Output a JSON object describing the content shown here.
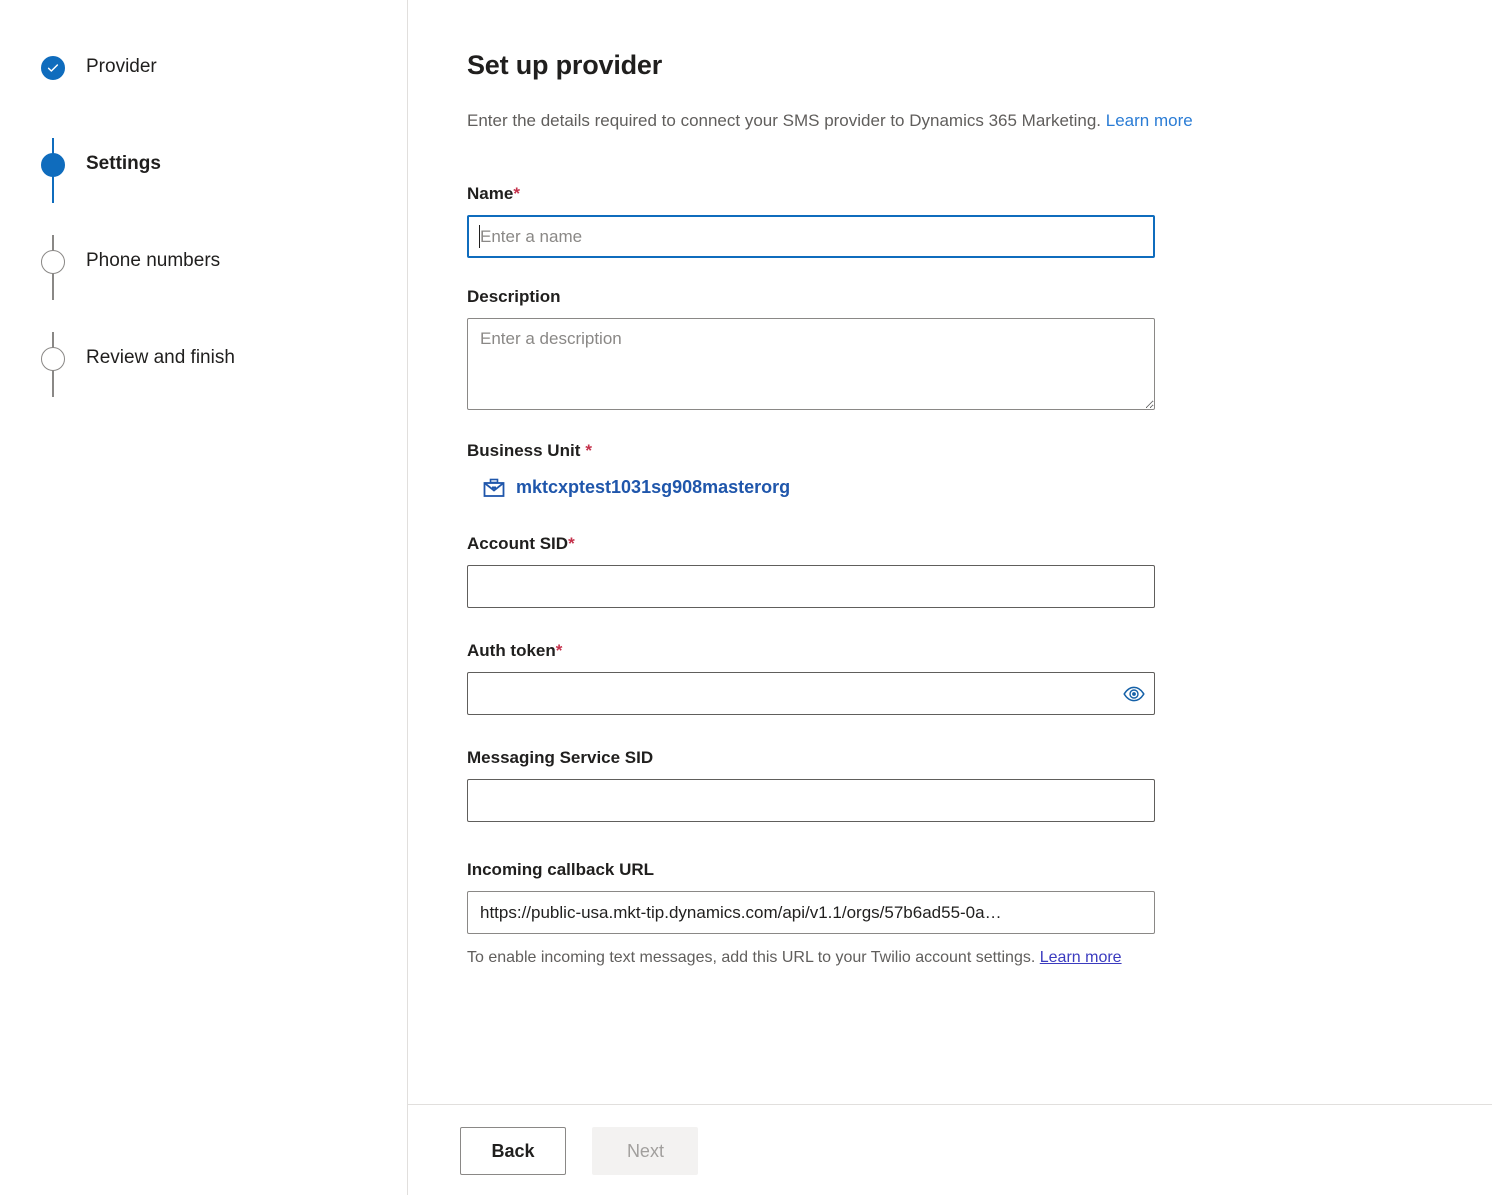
{
  "stepper": {
    "steps": [
      {
        "label": "Provider",
        "state": "completed",
        "icon": "check-icon"
      },
      {
        "label": "Settings",
        "state": "current",
        "icon": "filled-circle-icon"
      },
      {
        "label": "Phone numbers",
        "state": "upcoming",
        "icon": "empty-circle-icon"
      },
      {
        "label": "Review and finish",
        "state": "upcoming",
        "icon": "empty-circle-icon"
      }
    ]
  },
  "header": {
    "title": "Set up provider",
    "subtitle": "Enter the details required to connect your SMS provider to Dynamics 365 Marketing.",
    "learn_more": "Learn more"
  },
  "form": {
    "name": {
      "label": "Name",
      "required_marker": "*",
      "value": "",
      "placeholder": "Enter a name",
      "focused": true
    },
    "description": {
      "label": "Description",
      "value": "",
      "placeholder": "Enter a description"
    },
    "business_unit": {
      "label": "Business Unit",
      "required_marker": "*",
      "value": "mktcxptest1031sg908masterorg",
      "icon": "briefcase-icon"
    },
    "account_sid": {
      "label": "Account SID",
      "required_marker": "*",
      "value": "",
      "placeholder": ""
    },
    "auth_token": {
      "label": "Auth token",
      "required_marker": "*",
      "value": "",
      "placeholder": "",
      "reveal_icon": "eye-icon"
    },
    "messaging_service_sid": {
      "label": "Messaging Service SID",
      "value": "",
      "placeholder": ""
    },
    "incoming_callback_url": {
      "label": "Incoming callback URL",
      "value": "https://public-usa.mkt-tip.dynamics.com/api/v1.1/orgs/57b6ad55-0a…",
      "helper_text": "To enable incoming text messages, add this URL to your Twilio account settings.",
      "helper_link": "Learn more"
    }
  },
  "footer": {
    "back_label": "Back",
    "next_label": "Next",
    "next_disabled": true
  },
  "colors": {
    "accent": "#0f6cbd",
    "link": "#2a7cd5",
    "link_visited": "#3b3bbf",
    "required": "#c4314b",
    "border": "#8a8886",
    "divider": "#e1dfdd",
    "text": "#201f1e",
    "text_secondary": "#605e5c",
    "disabled_bg": "#f3f2f1",
    "disabled_text": "#a19f9d",
    "business_unit_link": "#1f56ab"
  }
}
